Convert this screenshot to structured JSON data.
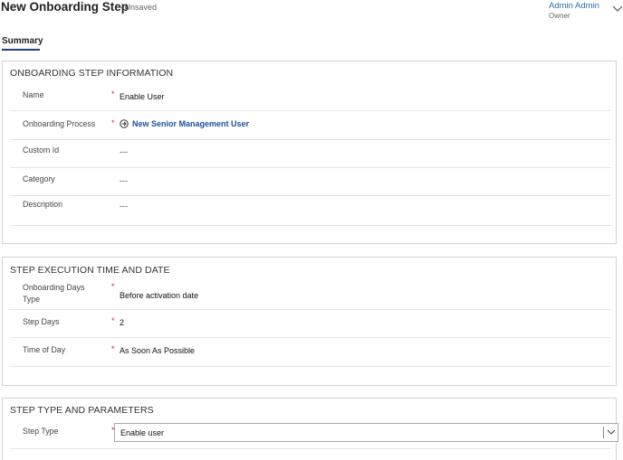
{
  "header": {
    "title": "New Onboarding Step",
    "status": "- Unsaved",
    "owner_name": "Admin Admin",
    "owner_role": "Owner",
    "expand_icon": "chevron-down-icon"
  },
  "tabs": [
    {
      "label": "Summary",
      "selected": true
    }
  ],
  "sections": {
    "info": {
      "title": "ONBOARDING STEP INFORMATION",
      "fields": {
        "name": {
          "label": "Name",
          "required": "*",
          "value": "Enable User"
        },
        "process": {
          "label": "Onboarding Process",
          "required": "*",
          "value": "New Senior Management User",
          "icon": "lookup-record-icon"
        },
        "custom_id": {
          "label": "Custom Id",
          "value": "---"
        },
        "category": {
          "label": "Category",
          "value": "---"
        },
        "description": {
          "label": "Description",
          "value": "---"
        }
      }
    },
    "timing": {
      "title": "STEP EXECUTION TIME AND DATE",
      "fields": {
        "onboarding_days_type": {
          "label_line1": "Onboarding Days",
          "label_line2": "Type",
          "required": "*",
          "value": "Before activation date"
        },
        "step_days": {
          "label": "Step Days",
          "required": "*",
          "value": "2"
        },
        "time_of_day": {
          "label": "Time of Day",
          "required": "*",
          "value": "As Soon As Possible"
        }
      }
    },
    "params": {
      "title": "STEP TYPE AND PARAMETERS",
      "fields": {
        "step_type": {
          "label": "Step Type",
          "required": "*",
          "value": "Enable user"
        }
      }
    }
  },
  "colors": {
    "link": "#1e4f9c",
    "required": "#c0392b",
    "tab_underline": "#1f3f7a"
  }
}
